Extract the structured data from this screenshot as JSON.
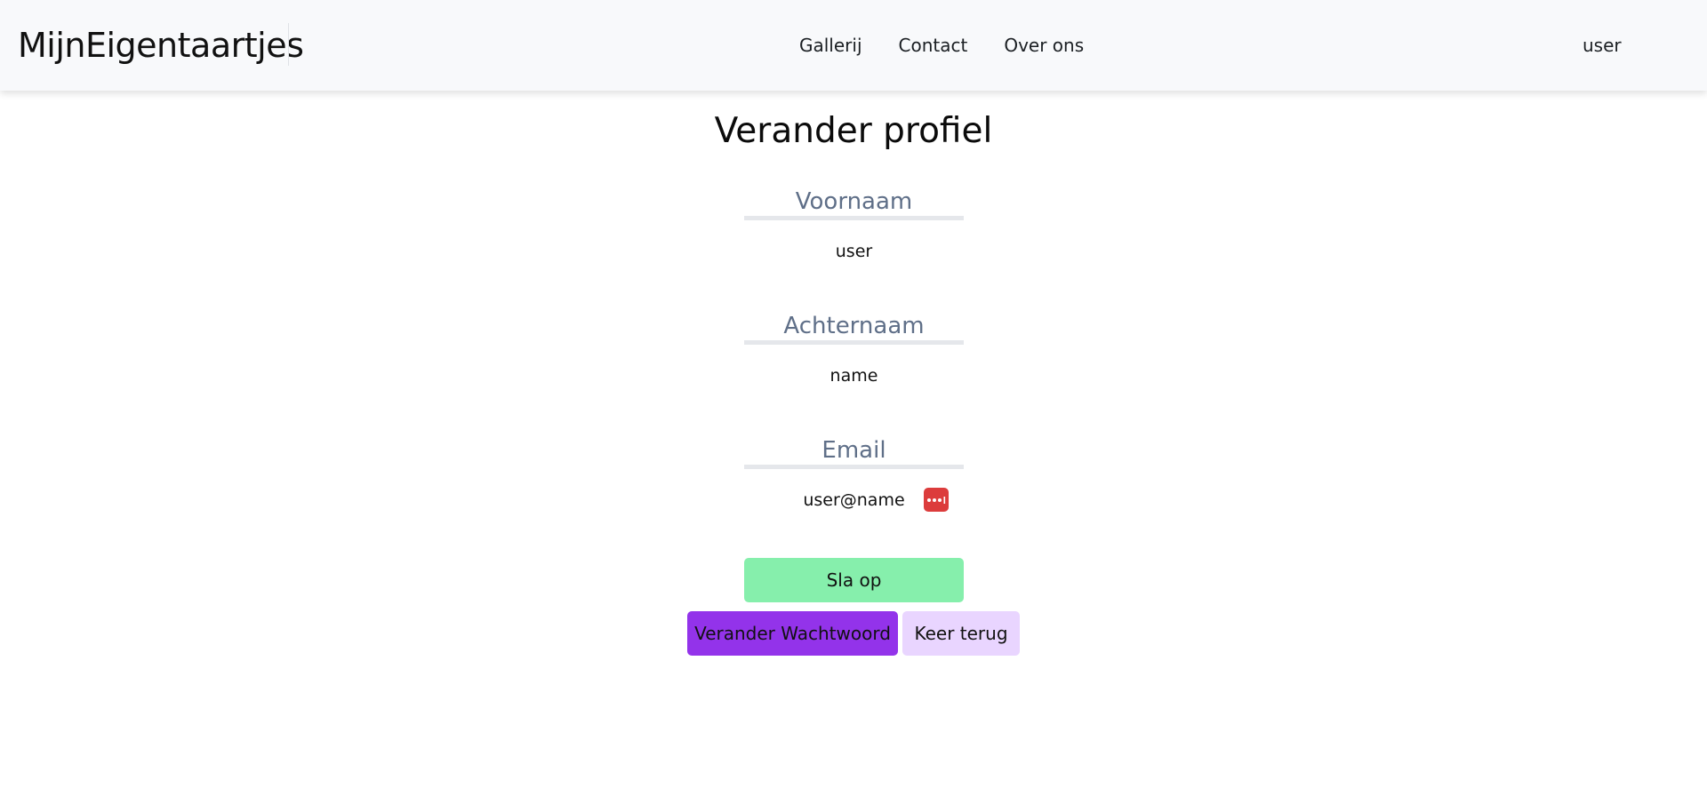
{
  "navbar": {
    "brand": "MijnEigentaartjes",
    "links": [
      {
        "label": "Gallerij"
      },
      {
        "label": "Contact"
      },
      {
        "label": "Over ons"
      }
    ],
    "user": "user"
  },
  "page": {
    "title": "Verander profiel"
  },
  "form": {
    "firstname": {
      "label": "Voornaam",
      "value": "user"
    },
    "lastname": {
      "label": "Achternaam",
      "value": "name"
    },
    "email": {
      "label": "Email",
      "value": "user@name"
    },
    "password_manager_icon": "password-manager-icon",
    "save_label": "Sla op",
    "change_password_label": "Verander Wachtwoord",
    "back_label": "Keer terug"
  },
  "colors": {
    "navbar_bg": "#f8f9fb",
    "label_text": "#5f6f88",
    "save_button": "#86efac",
    "change_password_button": "#9333ea",
    "back_button": "#e9d5ff",
    "password_icon": "#dc3c3c"
  }
}
